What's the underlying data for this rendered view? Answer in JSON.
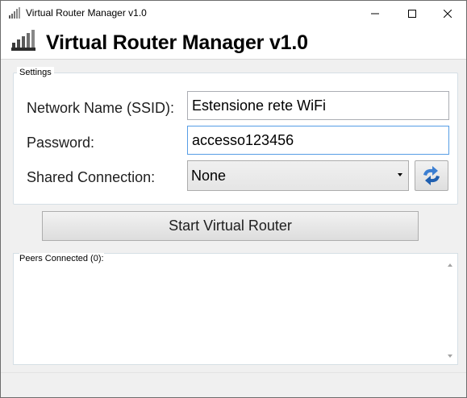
{
  "window": {
    "title": "Virtual Router Manager v1.0",
    "icon": "signal-bars-icon"
  },
  "header": {
    "title": "Virtual Router Manager v1.0",
    "icon": "router-signal-icon"
  },
  "settings": {
    "legend": "Settings",
    "ssid_label": "Network Name (SSID):",
    "ssid_value": "Estensione rete WiFi",
    "password_label": "Password:",
    "password_value": "accesso123456",
    "shared_label": "Shared Connection:",
    "shared_value": "None",
    "refresh_icon": "refresh-arrows-icon"
  },
  "actions": {
    "start_label": "Start Virtual Router"
  },
  "peers": {
    "label": "Peers Connected (0):",
    "items": []
  },
  "colors": {
    "focus_border": "#569de5",
    "refresh_arrow": "#3c7fd2"
  }
}
